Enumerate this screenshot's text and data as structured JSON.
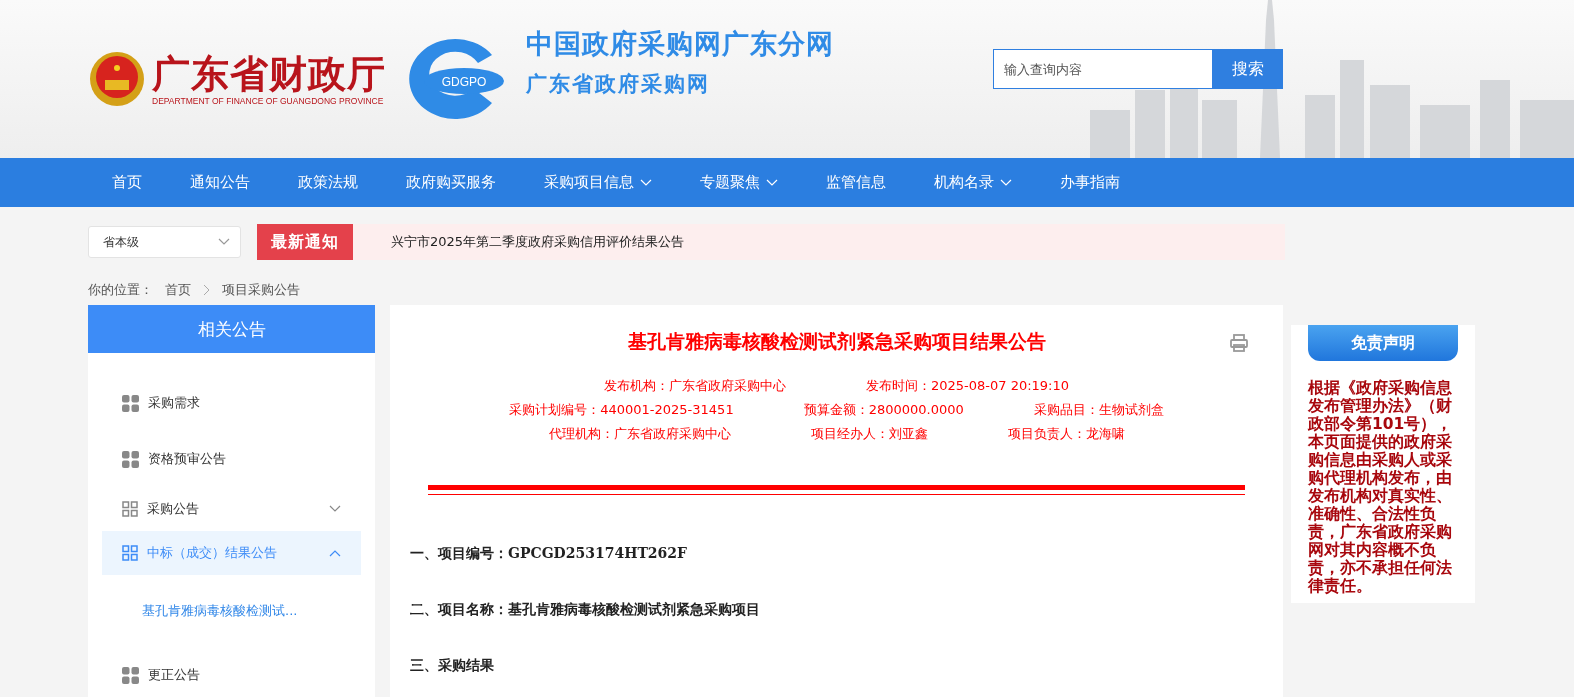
{
  "header": {
    "org_name": "广东省财政厅",
    "org_name_en": "DEPARTMENT OF FINANCE OF GUANGDONG PROVINCE",
    "logo_text": "GDGPO",
    "site_title": "中国政府采购网广东分网",
    "site_subtitle": "广东省政府采购网",
    "search": {
      "placeholder": "输入查询内容",
      "button": "搜索"
    }
  },
  "nav": [
    {
      "label": "首页",
      "dropdown": false
    },
    {
      "label": "通知公告",
      "dropdown": false
    },
    {
      "label": "政策法规",
      "dropdown": false
    },
    {
      "label": "政府购买服务",
      "dropdown": false
    },
    {
      "label": "采购项目信息",
      "dropdown": true
    },
    {
      "label": "专题聚焦",
      "dropdown": true
    },
    {
      "label": "监管信息",
      "dropdown": false
    },
    {
      "label": "机构名录",
      "dropdown": true
    },
    {
      "label": "办事指南",
      "dropdown": false
    }
  ],
  "region_select": {
    "value": "省本级"
  },
  "notice": {
    "badge": "最新通知",
    "text": "兴宁市2025年第二季度政府采购信用评价结果公告"
  },
  "breadcrumb": {
    "label": "你的位置：",
    "items": [
      "首页",
      "项目采购公告"
    ]
  },
  "sidebar": {
    "title": "相关公告",
    "items": [
      {
        "kind": "leaf",
        "label": "采购需求"
      },
      {
        "kind": "leaf",
        "label": "资格预审公告"
      },
      {
        "kind": "group",
        "label": "采购公告",
        "expanded": false,
        "selected": false
      },
      {
        "kind": "group",
        "label": "中标（成交）结果公告",
        "expanded": true,
        "selected": true,
        "children": [
          {
            "label": "基孔肯雅病毒核酸检测试..."
          }
        ]
      },
      {
        "kind": "leaf",
        "label": "更正公告"
      }
    ]
  },
  "article": {
    "title": "基孔肯雅病毒核酸检测试剂紧急采购项目结果公告",
    "meta": [
      [
        {
          "label": "发布机构：",
          "value": "广东省政府采购中心"
        },
        {
          "label": "发布时间：",
          "value": "2025-08-07 20:19:10"
        }
      ],
      [
        {
          "label": "采购计划编号：",
          "value": "440001-2025-31451"
        },
        {
          "label": "预算金额：",
          "value": "2800000.0000"
        },
        {
          "label": "采购品目：",
          "value": "生物试剂盒"
        }
      ],
      [
        {
          "label": "代理机构：",
          "value": "广东省政府采购中心"
        },
        {
          "label": "项目经办人：",
          "value": "刘亚鑫"
        },
        {
          "label": "项目负责人：",
          "value": "龙海啸"
        }
      ]
    ],
    "paragraphs": [
      "一、项目编号：GPCGD253174HT262F",
      "二、项目名称：基孔肯雅病毒核酸检测试剂紧急采购项目",
      "三、采购结果"
    ]
  },
  "disclaimer": {
    "title": "免责声明",
    "text": "根据《政府采购信息发布管理办法》（财政部令第101号），本页面提供的政府采购信息由采购人或采购代理机构发布，由发布机构对真实性、准确性、合法性负责，广东省政府采购网对其内容概不负责，亦不承担任何法律责任。"
  }
}
